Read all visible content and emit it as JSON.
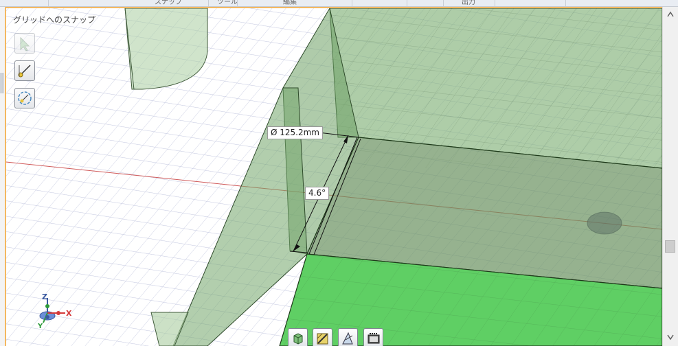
{
  "topbar": {
    "tabs": [
      "スナップ",
      "ツール",
      "編集",
      "出力"
    ]
  },
  "viewport": {
    "snap_label": "グリッドへのスナップ",
    "left_tools": [
      {
        "name": "select-arrow-icon",
        "enabled": false
      },
      {
        "name": "sketch-line-icon",
        "enabled": true
      },
      {
        "name": "orbit-rotate-icon",
        "enabled": true
      }
    ],
    "dimensions": {
      "diameter": "Ø 125.2mm",
      "angle": "4.6°"
    },
    "bottom_toolbar": [
      {
        "name": "view-cube-icon"
      },
      {
        "name": "material-pencil-icon"
      },
      {
        "name": "render-style-icon"
      },
      {
        "name": "film-camera-icon"
      }
    ],
    "axis_triad": {
      "x": "X",
      "y": "Y",
      "z": "Z"
    },
    "colors": {
      "grid": "#c4c8e0",
      "transparent_green": "#8fb886",
      "solid_green": "#5fcf64",
      "accent_border": "#f4b860",
      "red_axis": "#d05a5a"
    }
  }
}
